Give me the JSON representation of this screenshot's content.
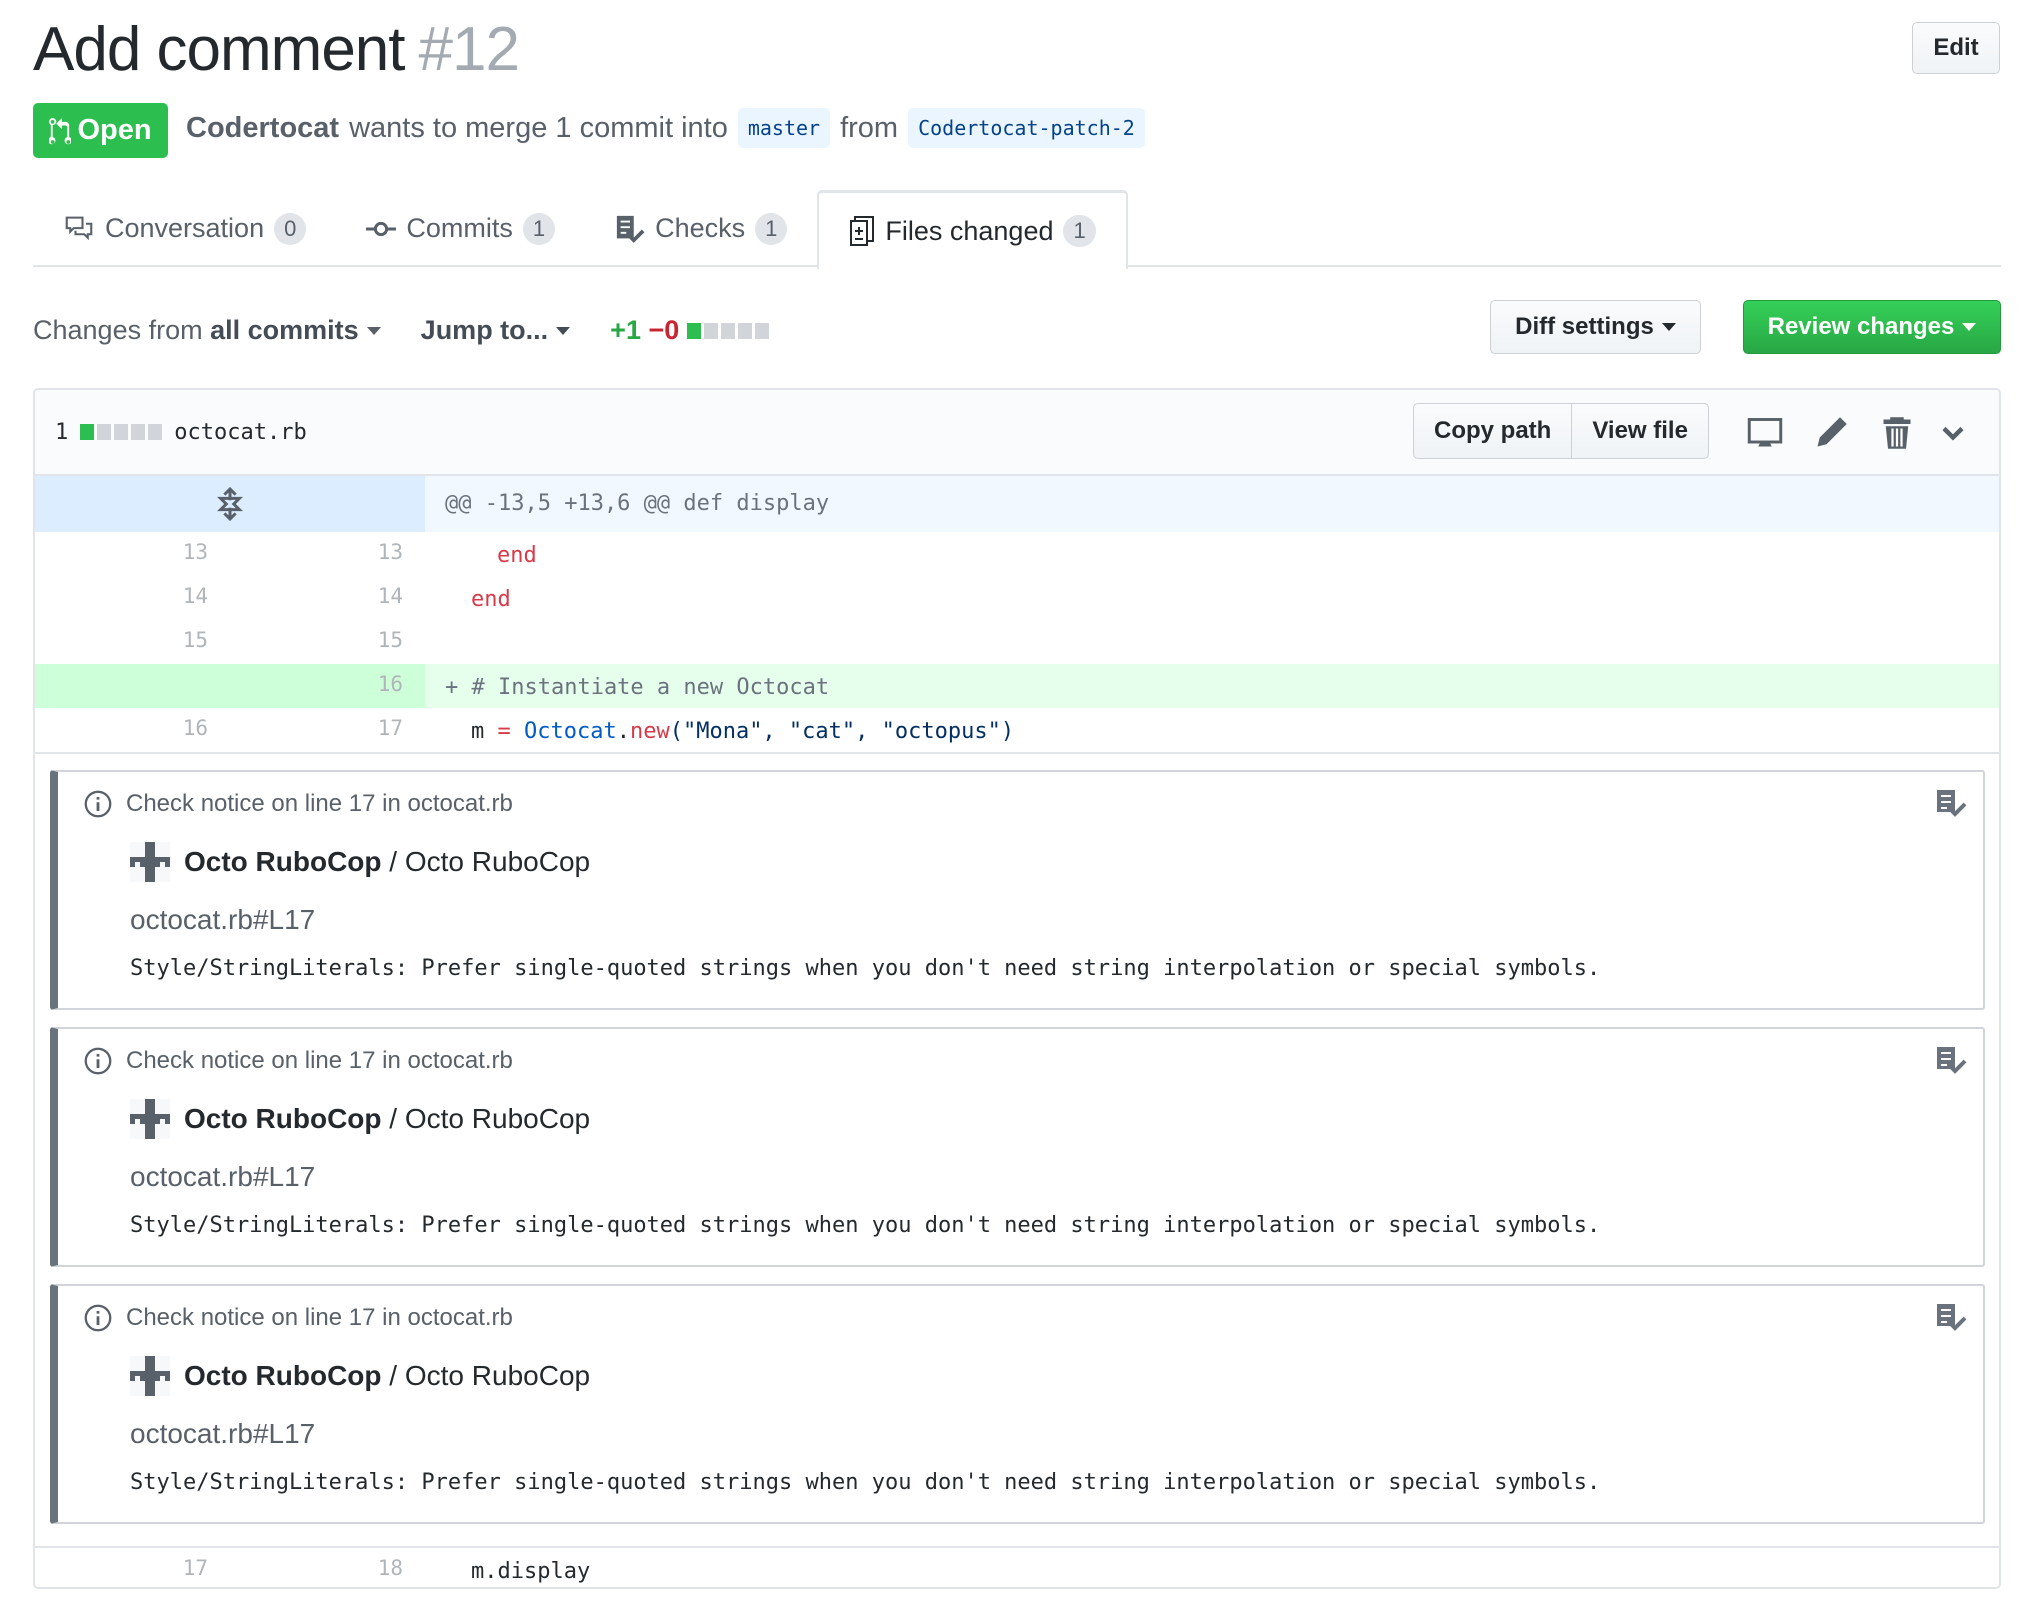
{
  "pr": {
    "title": "Add comment",
    "number": "#12",
    "edit_label": "Edit",
    "state": "Open",
    "author": "Codertocat",
    "merge_text": "wants to merge 1 commit into",
    "base": "master",
    "from": "from",
    "head": "Codertocat-patch-2"
  },
  "tabs": [
    {
      "label": "Conversation",
      "count": "0",
      "icon": "comment-discussion-icon"
    },
    {
      "label": "Commits",
      "count": "1",
      "icon": "git-commit-icon"
    },
    {
      "label": "Checks",
      "count": "1",
      "icon": "checklist-icon"
    },
    {
      "label": "Files changed",
      "count": "1",
      "icon": "file-diff-icon",
      "selected": true
    }
  ],
  "toolbar": {
    "changes_prefix": "Changes from",
    "changes_value": "all commits",
    "jump": "Jump to...",
    "additions": "+1",
    "deletions": "−0",
    "diff_settings": "Diff settings",
    "review": "Review changes"
  },
  "file": {
    "changes": "1",
    "name": "octocat.rb",
    "copy_path": "Copy path",
    "view_file": "View file",
    "hunk": "@@ -13,5 +13,6 @@ def display",
    "lines": [
      {
        "old": "13",
        "new": "13"
      },
      {
        "old": "14",
        "new": "14"
      },
      {
        "old": "15",
        "new": "15"
      },
      {
        "old": "",
        "new": "16"
      },
      {
        "old": "16",
        "new": "17"
      },
      {
        "old": "17",
        "new": "18"
      }
    ],
    "code": {
      "l13": "end",
      "l14": "end",
      "l16": "+ # Instantiate a new Octocat",
      "l17_var": "m ",
      "l17_eq": "=",
      "l17_cls": "Octocat",
      "l17_dot": ".",
      "l17_new": "new",
      "l17_args": "(\"Mona\", \"cat\", \"octopus\")",
      "l18": "m.display"
    }
  },
  "checks": [
    {
      "header": "Check notice on line 17 in octocat.rb",
      "app": "Octo RuboCop",
      "sep": " / ",
      "app2": "Octo RuboCop",
      "path": "octocat.rb#L17",
      "message": "Style/StringLiterals: Prefer single-quoted strings when you don't need string interpolation or special symbols."
    },
    {
      "header": "Check notice on line 17 in octocat.rb",
      "app": "Octo RuboCop",
      "sep": " / ",
      "app2": "Octo RuboCop",
      "path": "octocat.rb#L17",
      "message": "Style/StringLiterals: Prefer single-quoted strings when you don't need string interpolation or special symbols."
    },
    {
      "header": "Check notice on line 17 in octocat.rb",
      "app": "Octo RuboCop",
      "sep": " / ",
      "app2": "Octo RuboCop",
      "path": "octocat.rb#L17",
      "message": "Style/StringLiterals: Prefer single-quoted strings when you don't need string interpolation or special symbols."
    }
  ],
  "colors": {
    "green": "#2cbe4e",
    "red": "#cb2431",
    "add_bg": "#e6ffed",
    "hunk_bg": "#f1f8ff"
  }
}
